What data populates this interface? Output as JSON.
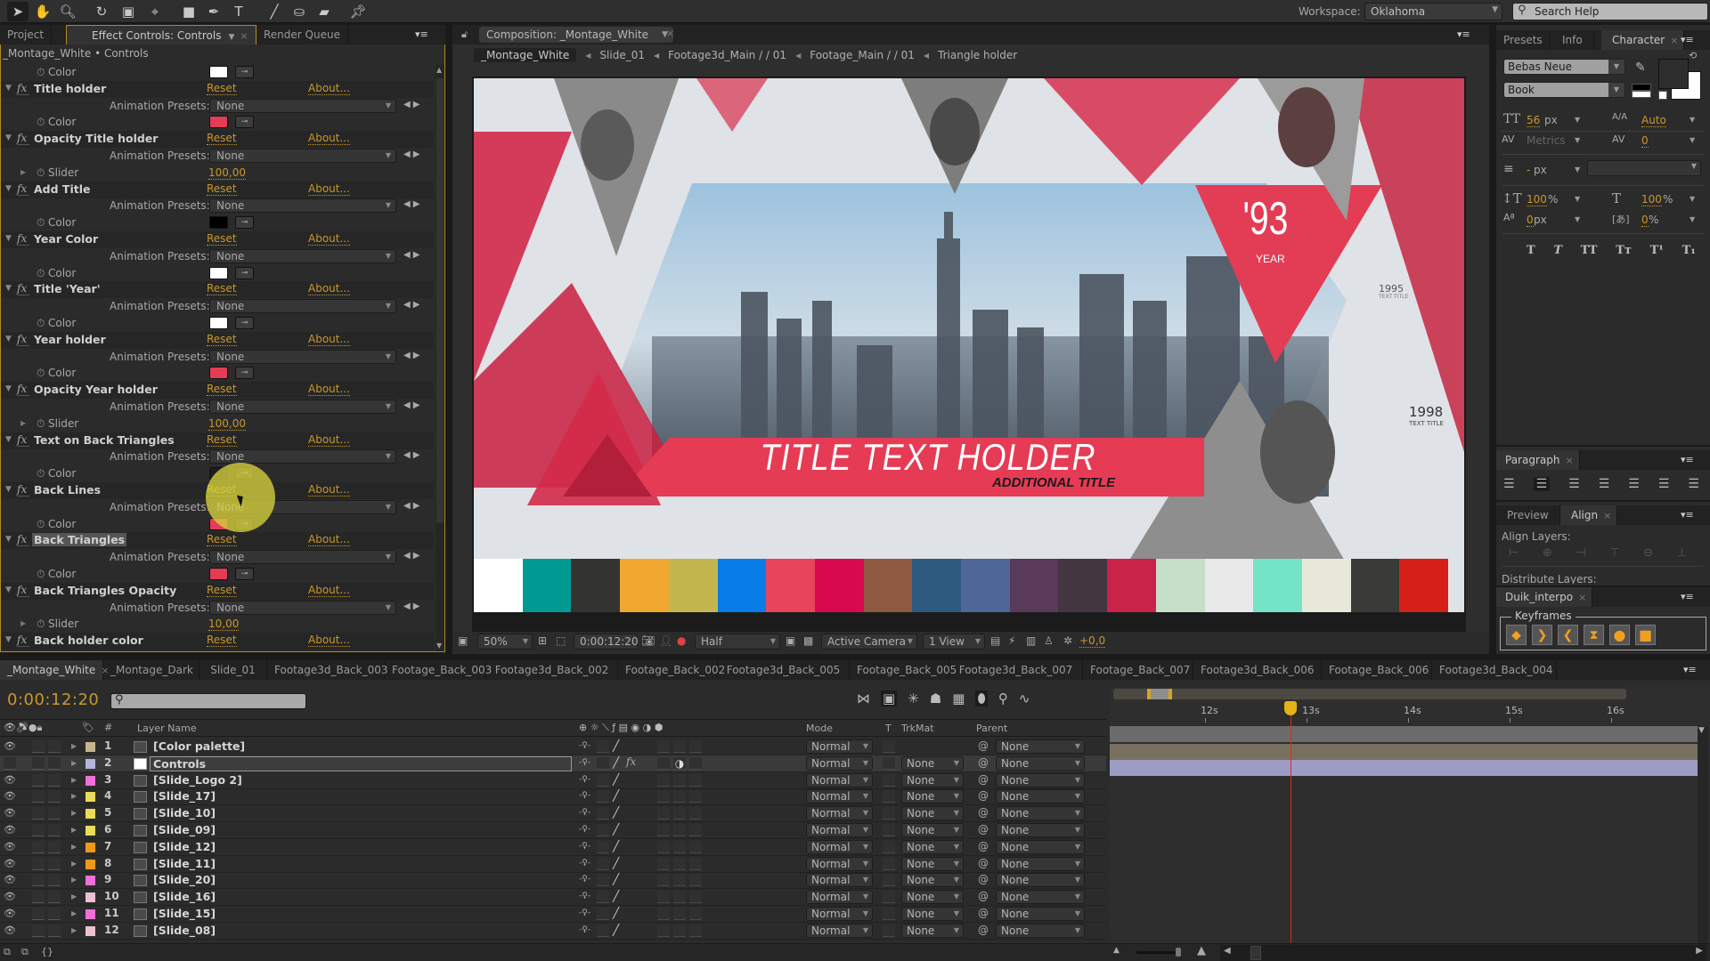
{
  "toolbar": {
    "tools": [
      "selection-tool",
      "hand-tool",
      "zoom-tool",
      "rotation-tool",
      "camera-tool",
      "pan-behind-tool",
      "rectangle-tool",
      "pen-tool",
      "type-tool",
      "brush-tool",
      "clone-stamp-tool",
      "eraser-tool",
      "puppet-pin-tool"
    ],
    "workspace_label": "Workspace:",
    "workspace_value": "Oklahoma",
    "search_placeholder": "Search Help"
  },
  "left_panel": {
    "tabs": [
      {
        "label": "Project"
      },
      {
        "label": "Effect Controls: Controls"
      },
      {
        "label": "Render Queue"
      }
    ],
    "breadcrumb": "_Montage_White • Controls",
    "reset_label": "Reset",
    "about_label": "About...",
    "presets_label": "Animation Presets:",
    "presets_value": "None",
    "top_color_row": {
      "label": "Color",
      "color": "#ffffff"
    },
    "effects": [
      {
        "name": "Title holder",
        "prop": "Color",
        "type": "color",
        "value": "#e23d55"
      },
      {
        "name": "Opacity Title holder",
        "prop": "Slider",
        "type": "slider",
        "value": "100,00"
      },
      {
        "name": "Add Title",
        "prop": "Color",
        "type": "color",
        "value": "#000000"
      },
      {
        "name": "Year Color",
        "prop": "Color",
        "type": "color",
        "value": "#ffffff"
      },
      {
        "name": "Title 'Year'",
        "prop": "Color",
        "type": "color",
        "value": "#ffffff"
      },
      {
        "name": "Year holder",
        "prop": "Color",
        "type": "color",
        "value": "#e23d55"
      },
      {
        "name": "Opacity Year holder",
        "prop": "Slider",
        "type": "slider",
        "value": "100,00"
      },
      {
        "name": "Text on Back Triangles",
        "prop": "Color",
        "type": "color",
        "value": "#1e1e1e"
      },
      {
        "name": "Back Lines",
        "prop": "Color",
        "type": "color",
        "value": "#e23d55"
      },
      {
        "name": "Back Triangles",
        "prop": "Color",
        "type": "color",
        "value": "#e23d55",
        "selected": true
      },
      {
        "name": "Back Triangles Opacity",
        "prop": "Slider",
        "type": "slider",
        "value": "10,00"
      },
      {
        "name": "Back holder color",
        "prop": "",
        "type": "header-only",
        "value": ""
      }
    ]
  },
  "composition": {
    "tab_label": "Composition: _Montage_White",
    "breadcrumbs": [
      "_Montage_White",
      "Slide_01",
      "Footage3d_Main / / 01",
      "Footage_Main / / 01",
      "Triangle holder"
    ],
    "preview": {
      "title": "TITLE TEXT HOLDER",
      "subtitle": "ADDITIONAL TITLE",
      "year_big": "'93",
      "year_label": "YEAR",
      "small_year_1": "1995",
      "small_title_1": "TEXT TITLE",
      "small_year_2": "1998",
      "small_title_2": "TEXT TITLE",
      "palette": [
        "#ffffff",
        "#009a92",
        "#33342f",
        "#f0a830",
        "#c3b64f",
        "#087de8",
        "#e8455a",
        "#d70a50",
        "#8e5a41",
        "#2e5a7e",
        "#4e6698",
        "#5a3a5a",
        "#433640",
        "#c9234a",
        "#c5dfc8",
        "#e8e8e8",
        "#74e4c8",
        "#e8e8da",
        "#3a3a36",
        "#d42018"
      ]
    },
    "footer": {
      "zoom": "50%",
      "timecode": "0:00:12:20",
      "resolution": "Half",
      "camera": "Active Camera",
      "views": "1 View",
      "exposure": "+0,0"
    }
  },
  "right_panel": {
    "tabs": [
      {
        "label": "Presets"
      },
      {
        "label": "Info"
      },
      {
        "label": "Character"
      }
    ],
    "character": {
      "font_family": "Bebas Neue",
      "font_style": "Book",
      "font_size": "56",
      "font_size_unit": "px",
      "leading": "Auto",
      "kerning": "Metrics",
      "tracking": "0",
      "stroke_width": "-",
      "stroke_unit": "px",
      "vertical_scale": "100",
      "horizontal_scale": "100",
      "baseline_shift": "0",
      "baseline_unit": "px",
      "tsume": "0",
      "percent": "%",
      "style_buttons": [
        "T",
        "T",
        "TT",
        "Tт",
        "T¹",
        "T₁"
      ]
    },
    "paragraph_tab": "Paragraph",
    "preview_tab": "Preview",
    "align_tab": "Align",
    "align_layers_label": "Align Layers:",
    "distribute_label": "Distribute Layers:",
    "duik_tab": "Duik_interpo",
    "keyframes_label": "Keyframes"
  },
  "timeline": {
    "tabs": [
      "_Montage_White",
      "_Montage_Dark",
      "Slide_01",
      "Footage3d_Back_003",
      "Footage_Back_003",
      "Footage3d_Back_002",
      "Footage_Back_002",
      "Footage3d_Back_005",
      "Footage_Back_005",
      "Footage3d_Back_007",
      "Footage_Back_007",
      "Footage3d_Back_006",
      "Footage_Back_006",
      "Footage3d_Back_004"
    ],
    "current_time": "0:00:12:20",
    "columns": {
      "num": "#",
      "layer_name": "Layer Name",
      "mode": "Mode",
      "t": "T",
      "trkmat": "TrkMat",
      "parent": "Parent"
    },
    "ruler_ticks": [
      "12s",
      "13s",
      "14s",
      "15s",
      "16s"
    ],
    "layers": [
      {
        "num": "1",
        "name": "[Color palette]",
        "label_color": "#c8b48c",
        "mode": "Normal",
        "trkmat": "",
        "parent": "None",
        "visible": true
      },
      {
        "num": "2",
        "name": "Controls",
        "label_color": "#b4b4dc",
        "mode": "Normal",
        "trkmat": "None",
        "parent": "None",
        "visible": false,
        "selected": true,
        "solid": true
      },
      {
        "num": "3",
        "name": "[Slide_Logo 2]",
        "label_color": "#f070d8",
        "mode": "Normal",
        "trkmat": "None",
        "parent": "None",
        "visible": true
      },
      {
        "num": "4",
        "name": "[Slide_17]",
        "label_color": "#e8dc5a",
        "mode": "Normal",
        "trkmat": "None",
        "parent": "None",
        "visible": true
      },
      {
        "num": "5",
        "name": "[Slide_10]",
        "label_color": "#e8dc5a",
        "mode": "Normal",
        "trkmat": "None",
        "parent": "None",
        "visible": true
      },
      {
        "num": "6",
        "name": "[Slide_09]",
        "label_color": "#e8dc5a",
        "mode": "Normal",
        "trkmat": "None",
        "parent": "None",
        "visible": true
      },
      {
        "num": "7",
        "name": "[Slide_12]",
        "label_color": "#ee9a18",
        "mode": "Normal",
        "trkmat": "None",
        "parent": "None",
        "visible": true
      },
      {
        "num": "8",
        "name": "[Slide_11]",
        "label_color": "#ee9a18",
        "mode": "Normal",
        "trkmat": "None",
        "parent": "None",
        "visible": true
      },
      {
        "num": "9",
        "name": "[Slide_20]",
        "label_color": "#f070d8",
        "mode": "Normal",
        "trkmat": "None",
        "parent": "None",
        "visible": true
      },
      {
        "num": "10",
        "name": "[Slide_16]",
        "label_color": "#ecc0d0",
        "mode": "Normal",
        "trkmat": "None",
        "parent": "None",
        "visible": true
      },
      {
        "num": "11",
        "name": "[Slide_15]",
        "label_color": "#f070d8",
        "mode": "Normal",
        "trkmat": "None",
        "parent": "None",
        "visible": true
      },
      {
        "num": "12",
        "name": "[Slide_08]",
        "label_color": "#ecc0d0",
        "mode": "Normal",
        "trkmat": "None",
        "parent": "None",
        "visible": true
      }
    ]
  }
}
